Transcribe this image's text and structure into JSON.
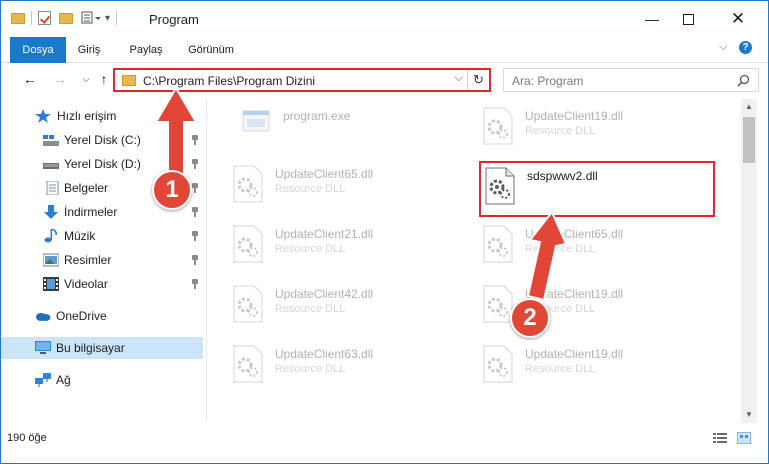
{
  "window": {
    "title": "Program"
  },
  "ribbon": {
    "tabs": [
      {
        "label": "Dosya",
        "active": true
      },
      {
        "label": "Giriş",
        "active": false
      },
      {
        "label": "Paylaş",
        "active": false
      },
      {
        "label": "Görünüm",
        "active": false
      }
    ]
  },
  "address": {
    "path": "C:\\Program Files\\Program Dizini"
  },
  "search": {
    "placeholder": "Ara: Program"
  },
  "sidebar": {
    "items": [
      {
        "label": "Hızlı erişim",
        "icon": "star-icon",
        "pinned": false
      },
      {
        "label": "Yerel Disk (C:)",
        "icon": "drive-icon",
        "pinned": true
      },
      {
        "label": "Yerel Disk (D:)",
        "icon": "drive-icon",
        "pinned": true
      },
      {
        "label": "Belgeler",
        "icon": "documents-icon",
        "pinned": true
      },
      {
        "label": "İndirmeler",
        "icon": "download-icon",
        "pinned": true
      },
      {
        "label": "Müzik",
        "icon": "music-icon",
        "pinned": true
      },
      {
        "label": "Resimler",
        "icon": "pictures-icon",
        "pinned": true
      },
      {
        "label": "Videolar",
        "icon": "video-icon",
        "pinned": true
      },
      {
        "label": "OneDrive",
        "icon": "cloud-icon",
        "pinned": false
      },
      {
        "label": "Bu bilgisayar",
        "icon": "computer-icon",
        "pinned": false,
        "selected": true
      },
      {
        "label": "Ağ",
        "icon": "network-icon",
        "pinned": false
      }
    ]
  },
  "files": [
    {
      "name": "program.exe",
      "type": "",
      "faded": true
    },
    {
      "name": "UpdateClient19.dll",
      "type": "Resource DLL",
      "faded": true
    },
    {
      "name": "UpdateClient65.dll",
      "type": "Resource DLL",
      "faded": true
    },
    {
      "name": "sdspwwv2.dll",
      "type": "",
      "faded": false
    },
    {
      "name": "UpdateClient21.dll",
      "type": "Resource DLL",
      "faded": true
    },
    {
      "name": "UpdateClient65.dll",
      "type": "Resource DLL",
      "faded": true
    },
    {
      "name": "UpdateClient42.dll",
      "type": "Resource DLL",
      "faded": true
    },
    {
      "name": "UpdateClient19.dll",
      "type": "Resource DLL",
      "faded": true
    },
    {
      "name": "UpdateClient63.dll",
      "type": "Resource DLL",
      "faded": true
    },
    {
      "name": "UpdateClient19.dll",
      "type": "Resource DLL",
      "faded": true
    }
  ],
  "status": {
    "item_count": "190 öğe"
  },
  "annotations": {
    "badge1": "1",
    "badge2": "2"
  },
  "colors": {
    "accent": "#1979ca",
    "highlight": "#e0282a",
    "badge": "#e24637"
  }
}
